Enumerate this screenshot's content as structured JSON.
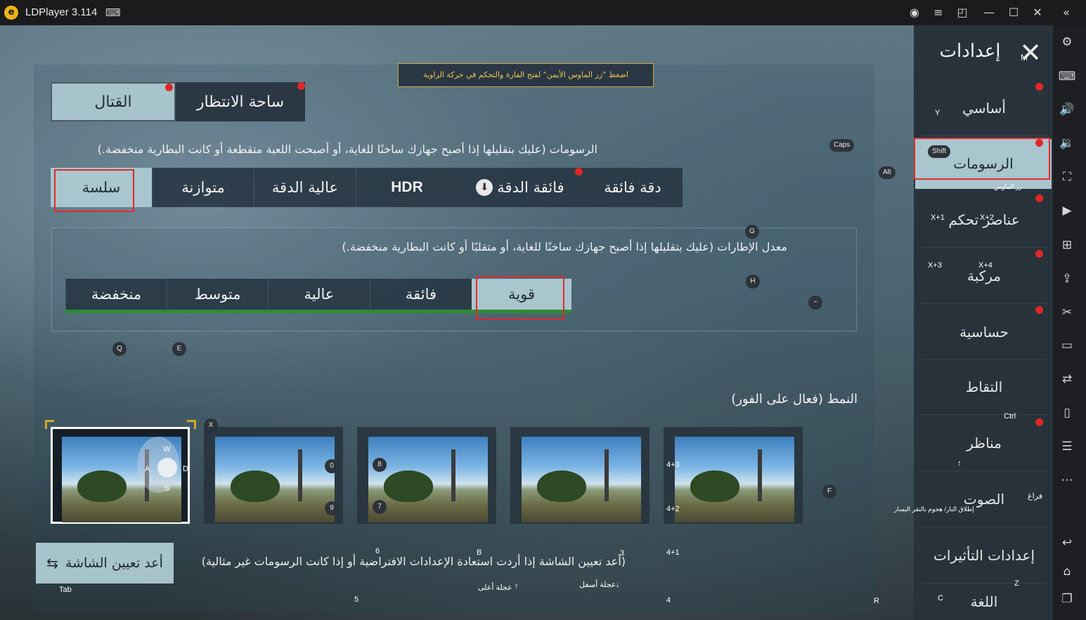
{
  "titlebar": {
    "app_name": "LDPlayer 3.114",
    "logo_icon": "ldplayer-logo-icon",
    "buttons": [
      "account-icon",
      "menu-icon",
      "restore-window-icon",
      "minimize-icon",
      "maximize-icon",
      "close-icon",
      "collapse-sidebar-icon"
    ]
  },
  "tip": "اضغط \"زر الماوس الأيمن\" لفتح الفارة والتحكم في حركة الزاوية",
  "tabs": [
    {
      "label": "القتال",
      "selected": true
    },
    {
      "label": "ساحة الانتظار",
      "selected": false
    }
  ],
  "graphics": {
    "description": "الرسومات (عليك بتقليلها إذا أصبح جهازك ساخنًا للغاية، أو أصبحت اللعبة متقطعة أو كانت البطارية منخفضة.)",
    "options": [
      "سلسة",
      "متوازنة",
      "عالية الدقة",
      "HDR",
      "فائقة الدقة",
      "دقة فائقة"
    ],
    "selected": "سلسة"
  },
  "framerate": {
    "description": "معدل الإطارات (عليك بتقليلها إذا أصبح جهازك ساخنًا للغاية، أو متقلبًا أو كانت البطارية منخفضة.)",
    "options": [
      "منخفضة",
      "متوسط",
      "عالية",
      "فائقة",
      "قوية"
    ],
    "selected": "قوية"
  },
  "styles": {
    "title": "النمط (فعال على الفور)",
    "count": 5,
    "selected_index": 0
  },
  "reset": {
    "button_label": "أعد تعيين الشاشة",
    "description": "(أعد تعيين الشاشة إذا أردت استعادة الإعدادات الافتراضية أو إذا كانت الرسومات غير مثالية)"
  },
  "sidebar": {
    "title": "إعدادات",
    "items": [
      "أساسي",
      "الرسومات",
      "عناصر تحكم",
      "مركبة",
      "حساسية",
      "التقاط",
      "مناظر",
      "الصوت",
      "إعدادات التأثيرات",
      "اللغة"
    ],
    "selected": "الرسومات"
  },
  "keys": {
    "caps": "Caps",
    "alt": "Alt",
    "shift": "Shift",
    "ctrl": "Ctrl",
    "tab": "Tab",
    "g": "G",
    "h": "H",
    "q": "Q",
    "e": "E",
    "x": "X",
    "y": "Y",
    "m": "M",
    "f": "F",
    "r": "R",
    "z": "Z",
    "c": "C",
    "b": "B",
    "n0": "0",
    "n9": "9",
    "n8": "8",
    "n7": "7",
    "n6": "6",
    "n5": "5",
    "n4": "4",
    "n3": "3",
    "x1": "X+1",
    "x2": "X+2",
    "x3": "X+3",
    "x4": "X+4",
    "k43": "4+3",
    "k42": "4+2",
    "k41": "4+1",
    "w": "W",
    "a": "A",
    "s": "S",
    "d": "D",
    "tilde": "~",
    "arrow_up": "↑",
    "mouse_label": "زر الماوس",
    "empty_label": "فراغ",
    "fire_label": "إطلاق النار/ هجوم بالنقر اليسار",
    "wheel_down": "عجلة أسفل",
    "wheel_up": "عجلة أعلى",
    "wheel_down_mark": "↓",
    "wheel_up_mark": "↑"
  },
  "rightbar": [
    "settings-icon",
    "keyboard-icon",
    "volume-up-icon",
    "volume-down-icon",
    "screenshot-icon",
    "play-record-icon",
    "add-window-icon",
    "apk-install-icon",
    "scissors-icon",
    "video-record-icon",
    "sync-icon",
    "shake-icon",
    "share-icon",
    "more-icon",
    "back-icon",
    "home-icon",
    "recent-apps-icon"
  ]
}
